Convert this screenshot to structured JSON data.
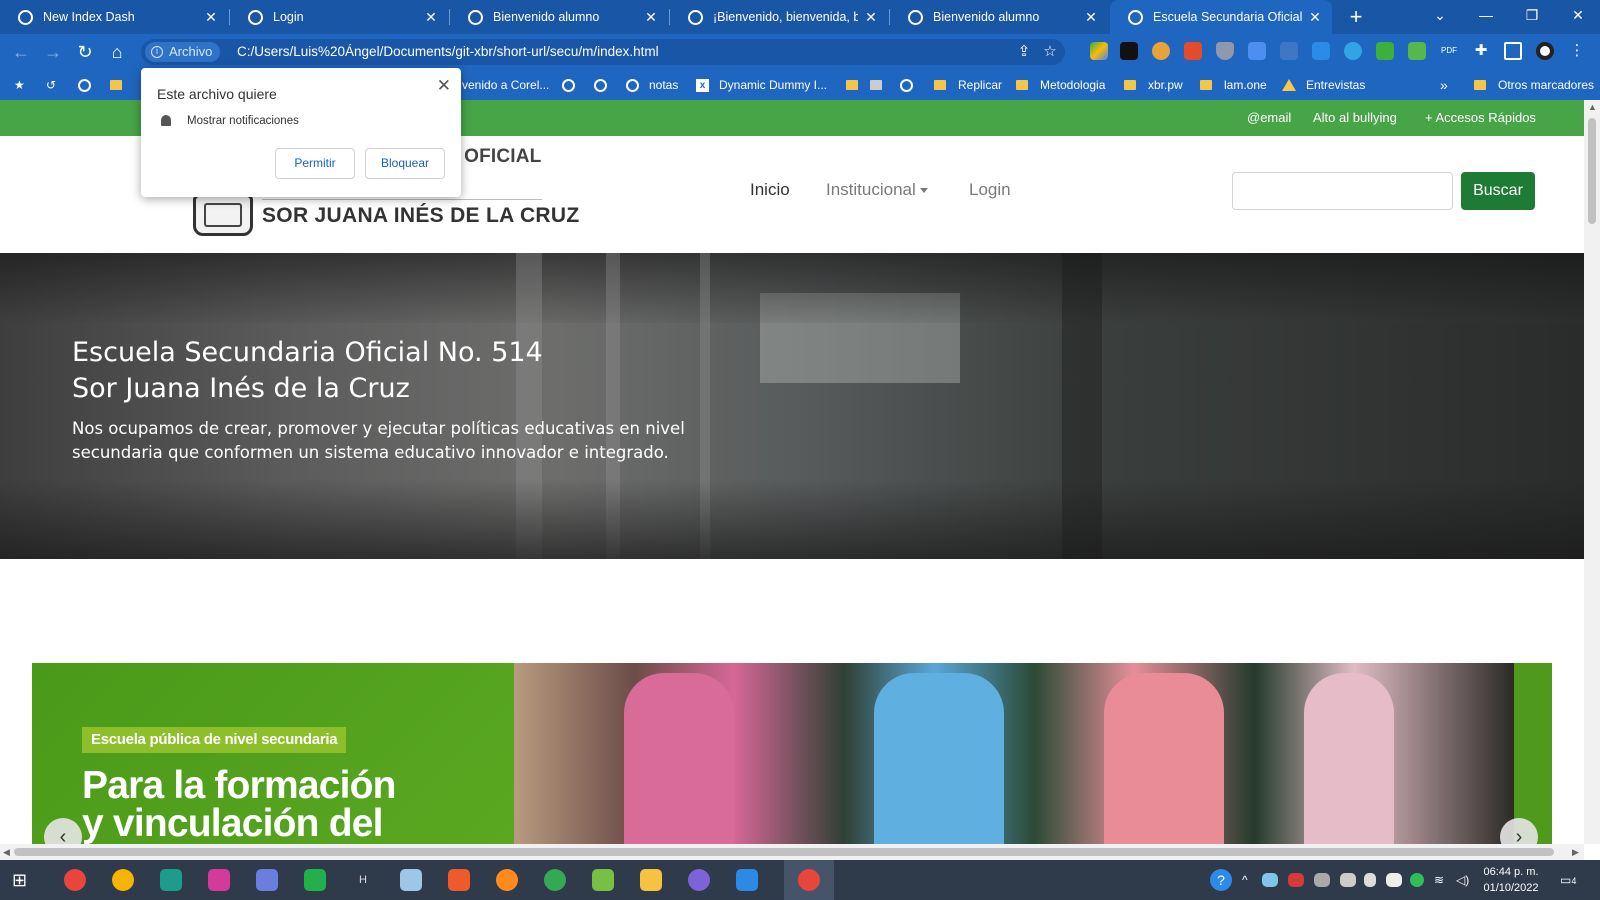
{
  "browser": {
    "tabs": [
      {
        "title": "New Index Dash",
        "active": false
      },
      {
        "title": "Login",
        "active": false
      },
      {
        "title": "Bienvenido alumno",
        "active": false
      },
      {
        "title": "¡Bienvenido, bienvenida, bien",
        "active": false
      },
      {
        "title": "Bienvenido alumno",
        "active": false
      },
      {
        "title": "Escuela Secundaria Oficial No",
        "active": true
      }
    ],
    "address": {
      "chip_label": "Archivo",
      "url": "C:/Users/Luis%20Ángel/Documents/git-xbr/short-url/secu/m/index.html"
    },
    "bookmarks": [
      {
        "label": "venido a Corel...",
        "icon": "globe-icon"
      },
      {
        "label": "",
        "icon": "globe-icon"
      },
      {
        "label": "",
        "icon": "globe-icon"
      },
      {
        "label": "notas",
        "icon": "globe-icon"
      },
      {
        "label": "Dynamic Dummy I...",
        "icon": "x-icon"
      },
      {
        "label": "",
        "icon": "folder-icon"
      },
      {
        "label": "",
        "icon": "camera-icon"
      },
      {
        "label": "",
        "icon": "globe-icon"
      },
      {
        "label": "Replicar",
        "icon": "folder-icon"
      },
      {
        "label": "Metodologia",
        "icon": "folder-icon"
      },
      {
        "label": "xbr.pw",
        "icon": "folder-icon"
      },
      {
        "label": "lam.one",
        "icon": "folder-icon"
      },
      {
        "label": "Entrevistas",
        "icon": "drive-icon"
      },
      {
        "label": "»",
        "icon": ""
      },
      {
        "label": "Otros marcadores",
        "icon": "folder-icon"
      }
    ]
  },
  "popup": {
    "title": "Este archivo quiere",
    "permission": "Mostrar notificaciones",
    "allow_label": "Permitir",
    "block_label": "Bloquear"
  },
  "site": {
    "topbar": {
      "email": "@email",
      "bullying": "Alto al bullying",
      "quick_access": "+ Accesos Rápidos"
    },
    "header": {
      "school_top": "RIA OFICIAL",
      "school_name": "SOR JUANA INÉS DE LA CRUZ",
      "nav": {
        "home": "Inicio",
        "institutional": "Institucional",
        "login": "Login"
      },
      "search_button": "Buscar",
      "search_value": ""
    },
    "hero": {
      "title_line1": "Escuela Secundaria Oficial No. 514",
      "title_line2": "Sor Juana Inés de la Cruz",
      "text": "Nos ocupamos de crear, promover y ejecutar políticas educativas en nivel secundaria que conformen un sistema educativo innovador e integrado."
    },
    "banner": {
      "tag": "Escuela pública de nivel secundaria",
      "headline_line1": "Para la formación",
      "headline_line2": "y vinculación del"
    }
  },
  "taskbar": {
    "clock_time": "06:44 p. m.",
    "clock_date": "01/10/2022",
    "notification_count": "4"
  },
  "colors": {
    "chrome_blue": "#1f66c1",
    "site_green": "#47a447",
    "search_button": "#1e7b34",
    "banner_green": "#4f9a1c"
  }
}
